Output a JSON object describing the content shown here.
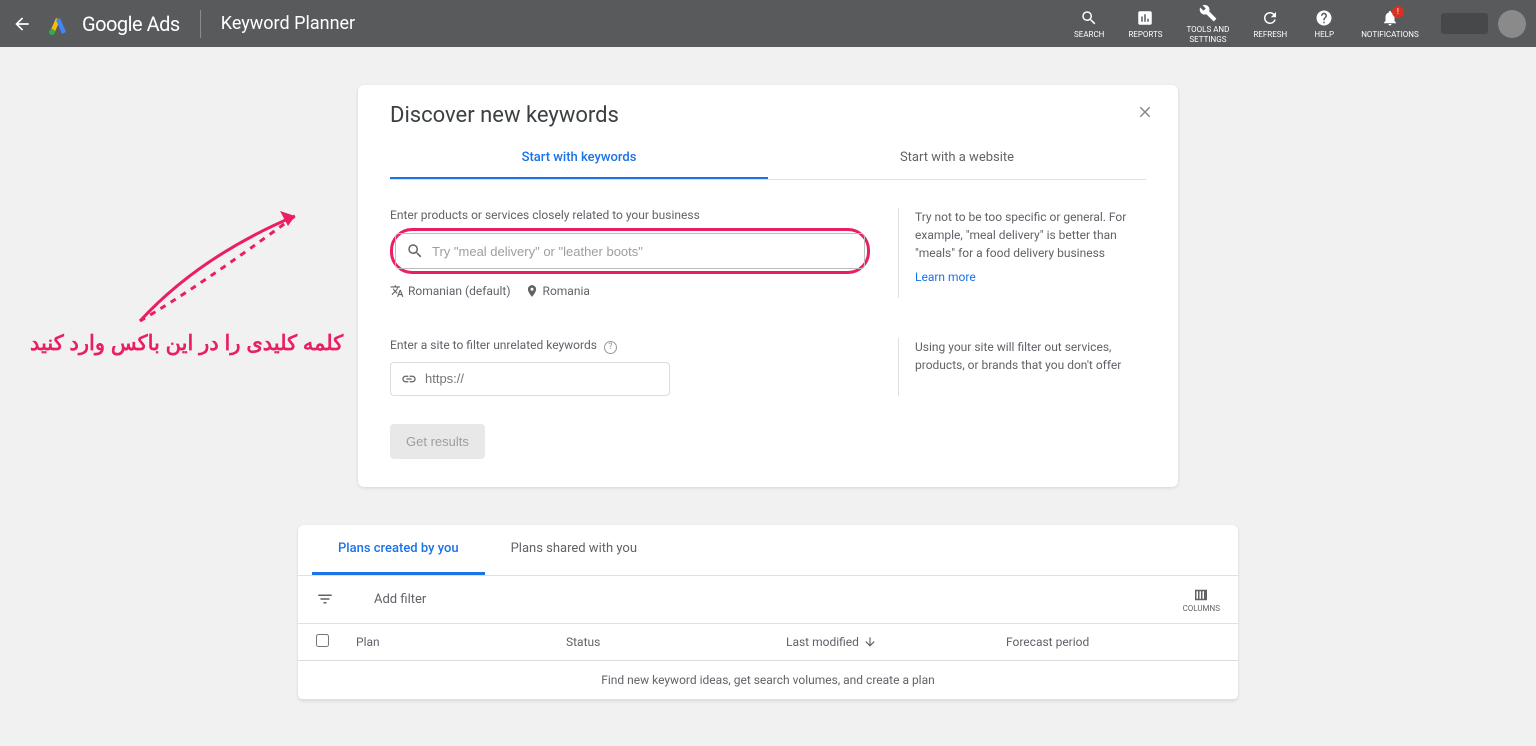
{
  "header": {
    "brand": "Google Ads",
    "app_title": "Keyword Planner",
    "nav": [
      {
        "id": "search",
        "label": "SEARCH"
      },
      {
        "id": "reports",
        "label": "REPORTS"
      },
      {
        "id": "tools",
        "label": "TOOLS AND\nSETTINGS"
      },
      {
        "id": "refresh",
        "label": "REFRESH"
      },
      {
        "id": "help",
        "label": "HELP"
      },
      {
        "id": "notifications",
        "label": "NOTIFICATIONS"
      }
    ]
  },
  "discover": {
    "title": "Discover new keywords",
    "tabs": {
      "keywords": "Start with keywords",
      "website": "Start with a website"
    },
    "field_label": "Enter products or services closely related to your business",
    "placeholder": "Try \"meal delivery\" or \"leather boots\"",
    "language": "Romanian (default)",
    "location": "Romania",
    "hint_keywords": "Try not to be too specific or general. For example, \"meal delivery\" is better than \"meals\" for a food delivery business",
    "learn_more": "Learn more",
    "site_label": "Enter a site to filter unrelated keywords",
    "site_placeholder": "https://",
    "hint_site": "Using your site will filter out services, products, or brands that you don't offer",
    "get_results": "Get results"
  },
  "plans": {
    "tabs": {
      "mine": "Plans created by you",
      "shared": "Plans shared with you"
    },
    "add_filter": "Add filter",
    "columns": "COLUMNS",
    "headers": {
      "plan": "Plan",
      "status": "Status",
      "modified": "Last modified",
      "forecast": "Forecast period"
    },
    "empty": "Find new keyword ideas, get search volumes, and create a plan"
  },
  "annotation": {
    "text": "کلمه کلیدی را در این باکس وارد کنید"
  }
}
